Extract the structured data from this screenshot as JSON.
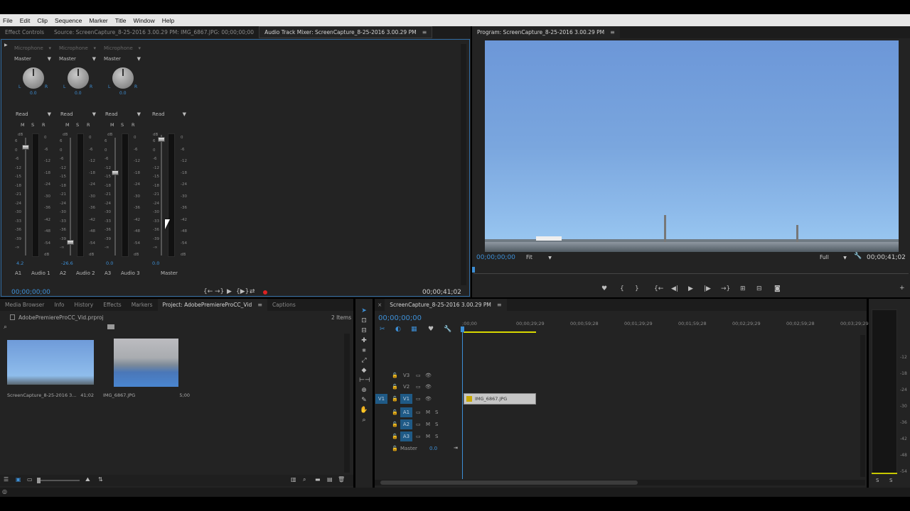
{
  "menu": [
    "File",
    "Edit",
    "Clip",
    "Sequence",
    "Marker",
    "Title",
    "Window",
    "Help"
  ],
  "source_tabs": {
    "effect_controls": "Effect Controls",
    "source": "Source: ScreenCapture_8-25-2016 3.00.29 PM: IMG_6867.JPG: 00;00;00;00",
    "audio_mixer": "Audio Track Mixer: ScreenCapture_8-25-2016 3.00.29 PM"
  },
  "mixer": {
    "channels": [
      {
        "input": "Microphone",
        "output": "Master",
        "pan": "0.0",
        "automation": "Read",
        "volume": "4.2",
        "id": "A1",
        "name": "Audio 1"
      },
      {
        "input": "Microphone",
        "output": "Master",
        "pan": "0.0",
        "automation": "Read",
        "volume": "-26.6",
        "id": "A2",
        "name": "Audio 2"
      },
      {
        "input": "Microphone",
        "output": "Master",
        "pan": "0.0",
        "automation": "Read",
        "volume": "0.0",
        "id": "A3",
        "name": "Audio 3"
      }
    ],
    "master": {
      "automation": "Read",
      "volume": "0.0",
      "name": "Master"
    },
    "msr": [
      "M",
      "S",
      "R"
    ],
    "pan_l": "L",
    "pan_r": "R",
    "db_label": "dB",
    "fader_scale": [
      "6",
      "0",
      "-6",
      "-12",
      "-15",
      "-18",
      "-21",
      "-24",
      "-30",
      "-33",
      "-36",
      "-39",
      "-∞"
    ],
    "meter_scale": [
      "0",
      "-6",
      "-12",
      "-18",
      "-24",
      "-30",
      "-36",
      "-42",
      "-48",
      "-54",
      "dB"
    ],
    "timecode_in": "00;00;00;00",
    "timecode_out": "00;00;41;02"
  },
  "program": {
    "tab": "Program: ScreenCapture_8-25-2016 3.00.29 PM",
    "timecode": "00;00;00;00",
    "fit": "Fit",
    "quality": "Full",
    "duration": "00;00;41;02"
  },
  "project_tabs": {
    "media_browser": "Media Browser",
    "info": "Info",
    "history": "History",
    "effects": "Effects",
    "markers": "Markers",
    "project": "Project: AdobePremiereProCC_Vid",
    "captions": "Captions"
  },
  "project": {
    "file": "AdobePremiereProCC_Vid.prproj",
    "count": "2 Items",
    "items": [
      {
        "name": "ScreenCapture_8-25-2016 3...",
        "duration": "41;02"
      },
      {
        "name": "IMG_6867.JPG",
        "duration": "5;00"
      }
    ]
  },
  "timeline": {
    "tab": "ScreenCapture_8-25-2016 3.00.29 PM",
    "timecode": "00;00;00;00",
    "ruler": [
      ";00;00",
      "00;00;29;29",
      "00;00;59;28",
      "00;01;29;29",
      "00;01;59;28",
      "00;02;29;29",
      "00;02;59;28",
      "00;03;29;29"
    ],
    "video_tracks": [
      "V3",
      "V2",
      "V1"
    ],
    "audio_tracks": [
      "A1",
      "A2",
      "A3"
    ],
    "source_patch_v": "V1",
    "master_label": "Master",
    "master_value": "0.0",
    "clip": "IMG_6867.JPG",
    "m": "M",
    "s": "S"
  },
  "audio_meters": {
    "scale": [
      "-12",
      "-18",
      "-24",
      "-30",
      "-36",
      "-42",
      "-48",
      "-54"
    ],
    "solo": [
      "S",
      "S"
    ]
  },
  "colors": {
    "accent": "#3d8fd6",
    "panel": "#232323",
    "timeline_clip": "#c6c6c6",
    "work_area": "#d8d800"
  }
}
